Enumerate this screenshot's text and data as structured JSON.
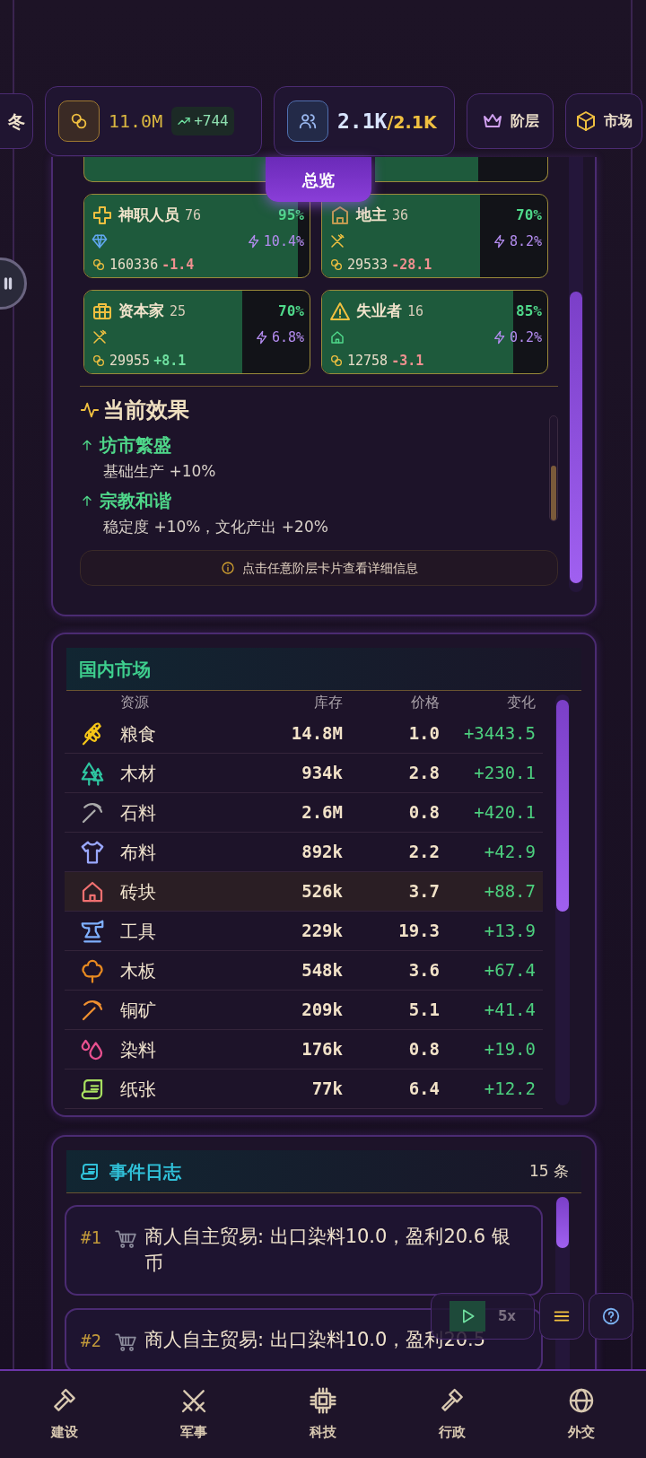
{
  "season": {
    "label": "冬"
  },
  "treasury": {
    "amount": "11.0M",
    "trend": "+744"
  },
  "population": {
    "current": "2.1K",
    "capacity": "/2.1K"
  },
  "nav_buttons": [
    {
      "label": "阶层"
    },
    {
      "label": "市场"
    }
  ],
  "overview_tab": {
    "label": "总览"
  },
  "strata": [
    {
      "name": "神职人员",
      "count": "76",
      "approval": "95%",
      "level": 0.95,
      "influence": "10.4%",
      "wealth": "160336",
      "delta": "-1.4",
      "color": "#f09090"
    },
    {
      "name": "地主",
      "count": "36",
      "approval": "70%",
      "level": 0.7,
      "influence": "8.2%",
      "wealth": "29533",
      "delta": "-28.1",
      "color": "#f09090"
    },
    {
      "name": "资本家",
      "count": "25",
      "approval": "70%",
      "level": 0.7,
      "influence": "6.8%",
      "wealth": "29955",
      "delta": "+8.1",
      "color": "#6fe0a0"
    },
    {
      "name": "失业者",
      "count": "16",
      "approval": "85%",
      "level": 0.85,
      "influence": "0.2%",
      "wealth": "12758",
      "delta": "-3.1",
      "color": "#f09090"
    }
  ],
  "effects": {
    "title": "当前效果",
    "items": [
      {
        "name": "坊市繁盛",
        "detail": "基础生产 +10%"
      },
      {
        "name": "宗教和谐",
        "detail": "稳定度 +10%，文化产出 +20%"
      }
    ]
  },
  "hint": "点击任意阶层卡片查看详细信息",
  "market": {
    "title": "国内市场",
    "columns": [
      "资源",
      "库存",
      "价格",
      "变化"
    ],
    "rows": [
      {
        "name": "粮食",
        "stock": "14.8M",
        "price": "1.0",
        "change": "+3443.5",
        "selected": false
      },
      {
        "name": "木材",
        "stock": "934k",
        "price": "2.8",
        "change": "+230.1",
        "selected": false
      },
      {
        "name": "石料",
        "stock": "2.6M",
        "price": "0.8",
        "change": "+420.1",
        "selected": false
      },
      {
        "name": "布料",
        "stock": "892k",
        "price": "2.2",
        "change": "+42.9",
        "selected": false
      },
      {
        "name": "砖块",
        "stock": "526k",
        "price": "3.7",
        "change": "+88.7",
        "selected": true
      },
      {
        "name": "工具",
        "stock": "229k",
        "price": "19.3",
        "change": "+13.9",
        "selected": false
      },
      {
        "name": "木板",
        "stock": "548k",
        "price": "3.6",
        "change": "+67.4",
        "selected": false
      },
      {
        "name": "铜矿",
        "stock": "209k",
        "price": "5.1",
        "change": "+41.4",
        "selected": false
      },
      {
        "name": "染料",
        "stock": "176k",
        "price": "0.8",
        "change": "+19.0",
        "selected": false
      },
      {
        "name": "纸张",
        "stock": "77k",
        "price": "6.4",
        "change": "+12.2",
        "selected": false
      }
    ]
  },
  "event_log": {
    "title": "事件日志",
    "count": "15 条",
    "entries": [
      {
        "number": "#1",
        "text": "商人自主贸易: 出口染料10.0，盈利20.6 银币"
      },
      {
        "number": "#2",
        "text": "商人自主贸易: 出口染料10.0，盈利20.5"
      }
    ]
  },
  "speed": {
    "label": "5x"
  },
  "bottom_nav": [
    {
      "label": "建设"
    },
    {
      "label": "军事"
    },
    {
      "label": "科技"
    },
    {
      "label": "行政"
    },
    {
      "label": "外交"
    }
  ]
}
